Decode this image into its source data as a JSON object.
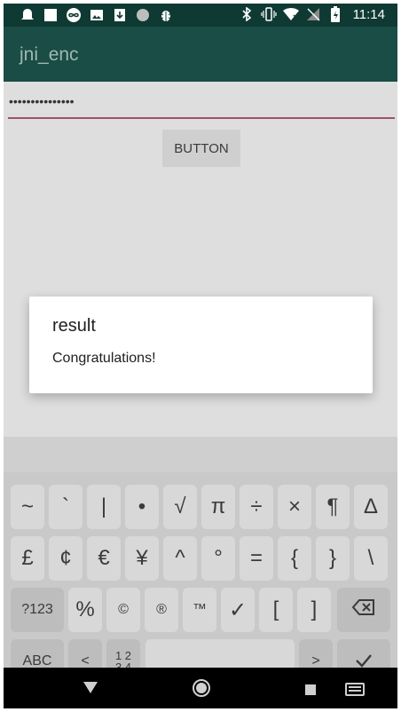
{
  "status_bar": {
    "time": "11:14",
    "left_icons": [
      "notification-ghost-icon",
      "notification-square-icon",
      "notification-infinity-icon",
      "image-icon",
      "download-icon",
      "circle-icon",
      "bug-icon"
    ],
    "right_icons": [
      "bluetooth-icon",
      "vibrate-icon",
      "wifi-icon",
      "no-signal-icon",
      "battery-charging-icon"
    ]
  },
  "app_bar": {
    "title": "jni_enc"
  },
  "form": {
    "password_value": "•••••••••••••••",
    "button_label": "BUTTON",
    "underline_color": "#a0506e"
  },
  "dialog": {
    "title": "result",
    "message": "Congratulations!"
  },
  "keyboard": {
    "row1": [
      "~",
      "`",
      "|",
      "•",
      "√",
      "π",
      "÷",
      "×",
      "¶",
      "∆"
    ],
    "row2": [
      "£",
      "¢",
      "€",
      "¥",
      "^",
      "°",
      "=",
      "{",
      "}",
      "\\"
    ],
    "row3": [
      "?123",
      "%",
      "©",
      "®",
      "™",
      "✓",
      "[",
      "]"
    ],
    "row4": {
      "abc": "ABC",
      "lt": "<",
      "numpad": "1 2\n3 4",
      "gt": ">"
    }
  },
  "nav_bar": {
    "icons": [
      "back-icon",
      "home-icon",
      "recents-icon",
      "keyboard-switch-icon"
    ]
  }
}
